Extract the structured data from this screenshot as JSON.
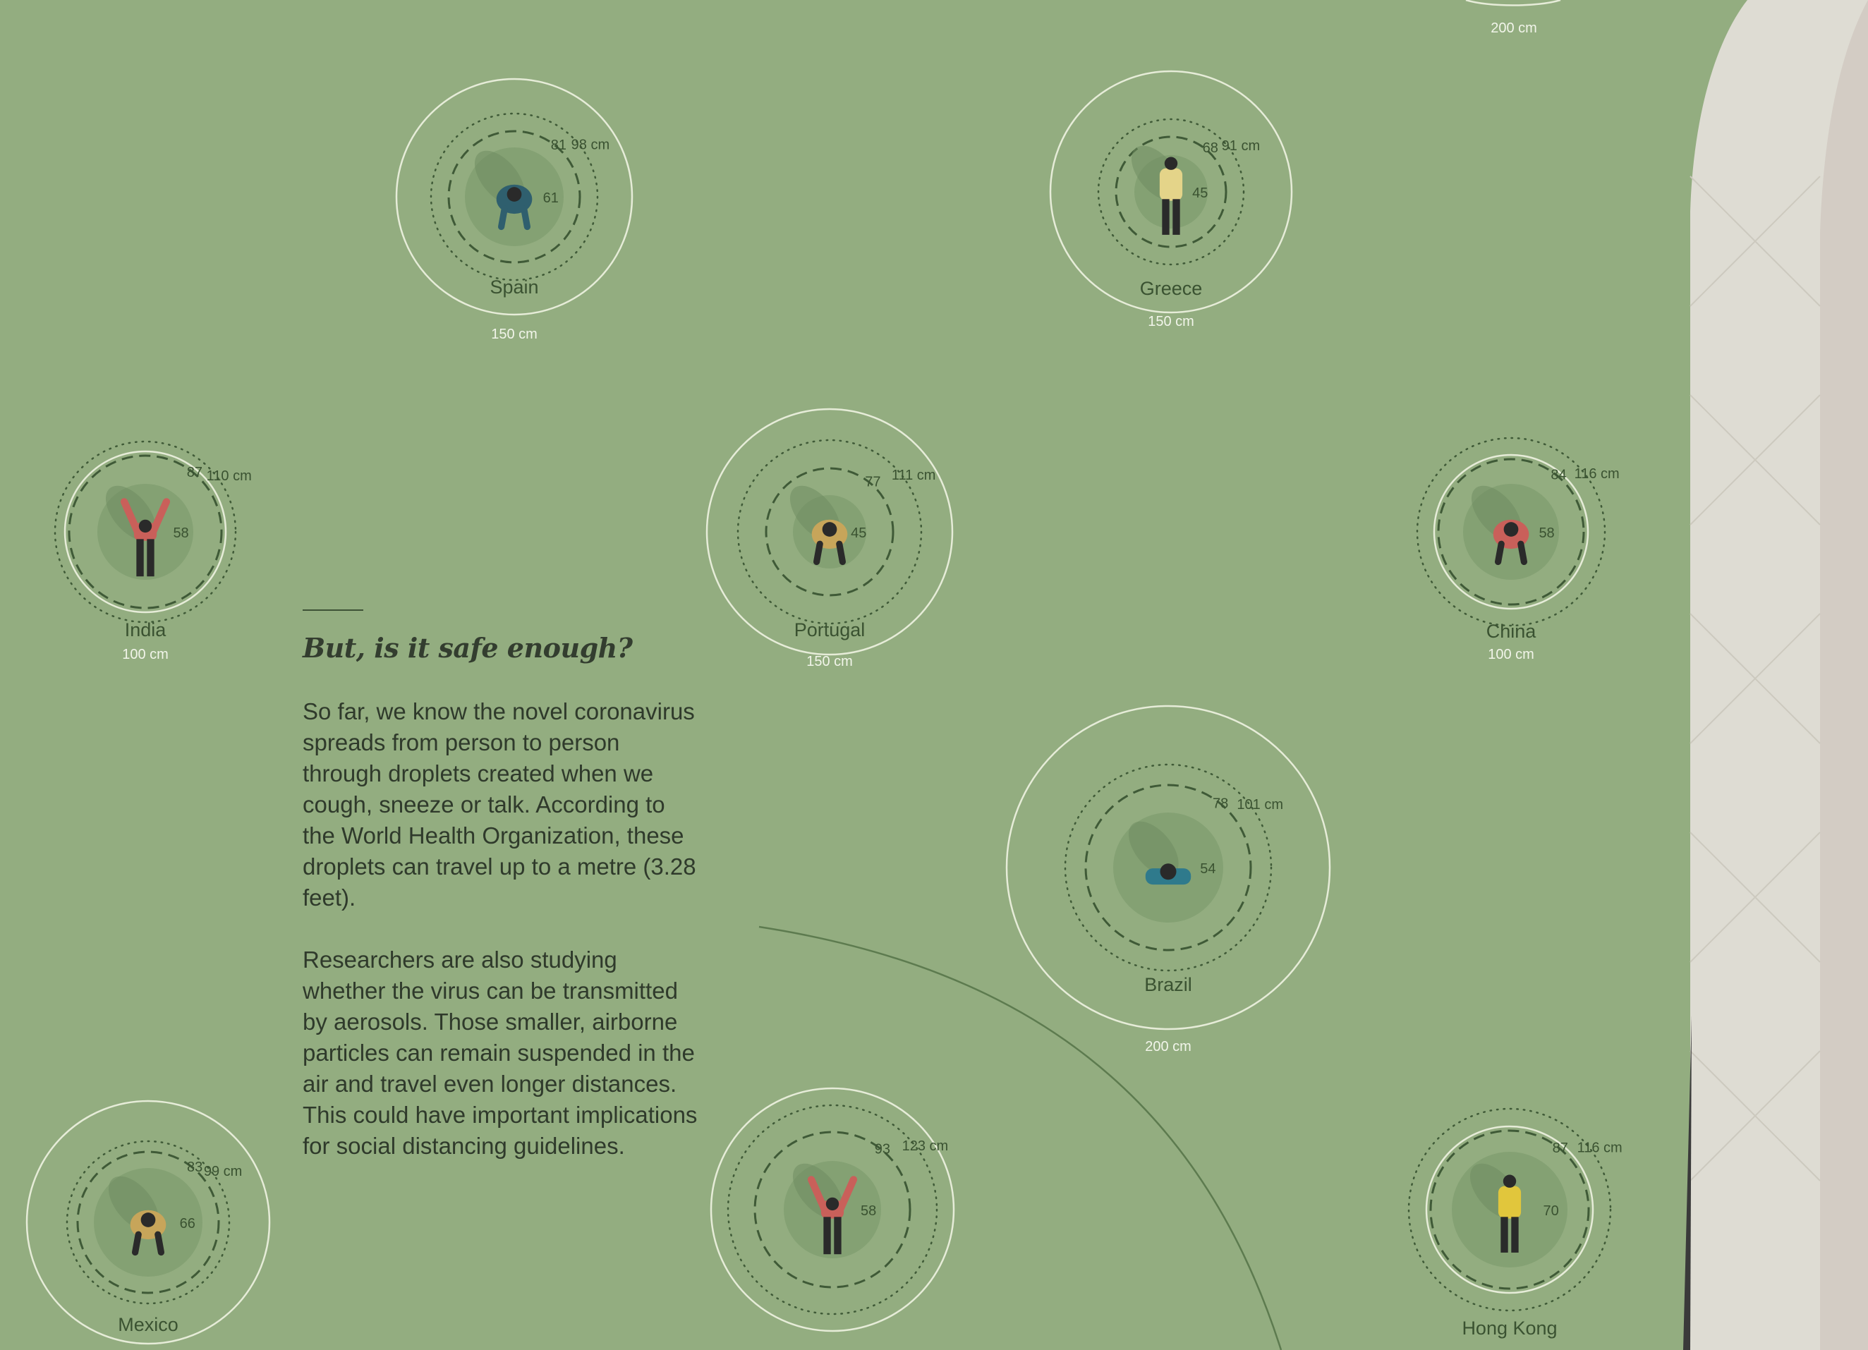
{
  "story": {
    "heading": "But, is it safe enough?",
    "paragraphs": [
      "So far, we know the novel coronavirus spreads from person to person through droplets created when we cough, sneeze or talk. According to the World Health Organization, these droplets can travel up to a metre (3.28 feet).",
      "Researchers are also studying whether the virus can be transmitted by aerosols. Those smaller, airborne particles can remain suspended in the air and travel even longer distances. This could have important implications for social distancing guidelines."
    ]
  },
  "countries": [
    {
      "name": "Spain",
      "guideline": "150 cm",
      "outer": "98 cm",
      "mid": "81",
      "inner": "61",
      "pose": "crouch",
      "shirt": "#2f5f6e",
      "pants": "#2f5f6e"
    },
    {
      "name": "Greece",
      "guideline": "150 cm",
      "outer": "91 cm",
      "mid": "68",
      "inner": "45",
      "pose": "stand",
      "shirt": "#e4d489",
      "pants": "#2a2a2a"
    },
    {
      "name": "India",
      "guideline": "100 cm",
      "outer": "110 cm",
      "mid": "87",
      "inner": "58",
      "pose": "arms",
      "shirt": "#c9605a",
      "pants": "#2a2a2a"
    },
    {
      "name": "Portugal",
      "guideline": "150 cm",
      "outer": "111 cm",
      "mid": "77",
      "inner": "45",
      "pose": "crouch",
      "shirt": "#c7a55a",
      "pants": "#2a2a2a"
    },
    {
      "name": "China",
      "guideline": "100 cm",
      "outer": "116 cm",
      "mid": "84",
      "inner": "58",
      "pose": "crouch",
      "shirt": "#c9605a",
      "pants": "#2a2a2a"
    },
    {
      "name": "Brazil",
      "guideline": "200 cm",
      "outer": "101 cm",
      "mid": "78",
      "inner": "54",
      "pose": "sit",
      "shirt": "#2f7a8c",
      "pants": "#2a2a2a"
    },
    {
      "name": "Mexico",
      "guideline": "",
      "outer": "99 cm",
      "mid": "83",
      "inner": "66",
      "pose": "crouch",
      "shirt": "#c7a55a",
      "pants": "#2a2a2a"
    },
    {
      "name": "",
      "guideline": "",
      "outer": "123 cm",
      "mid": "93",
      "inner": "58",
      "pose": "arms",
      "shirt": "#c9605a",
      "pants": "#2a2a2a"
    },
    {
      "name": "Hong Kong",
      "guideline": "",
      "outer": "116 cm",
      "mid": "87",
      "inner": "70",
      "pose": "stand",
      "shirt": "#e1c63c",
      "pants": "#2a2a2a"
    }
  ],
  "top_edge_label": "200 cm",
  "colors": {
    "background": "#93ad80",
    "guideline_circle": "#e6ecd8",
    "ring": "#3f5a37",
    "body_zone": "#84a173",
    "label": "#3a5231",
    "sidebar": "#dedcd3",
    "sidebar_shadow": "#d3ccc4"
  }
}
